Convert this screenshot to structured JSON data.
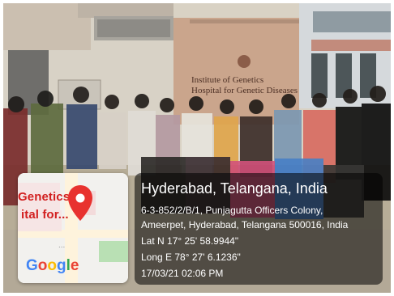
{
  "photo": {
    "building_sign": "Institute of Genetics\nHospital for Genetic Diseases",
    "colors": {
      "wall_light": "#d8d0c1",
      "wall_shadow": "#8c857b",
      "sign_panel": "#cdb49b",
      "ground": "#b7ad97",
      "sky": "#e9eef2"
    }
  },
  "map_overlay": {
    "label_line_1": "Genetics",
    "label_line_2": "ital for...",
    "map_logo": "Google",
    "pin_icon": "map-pin-icon",
    "pin_color": "#e8322f",
    "road_color": "#fef3dc",
    "park_color": "#b9e0b4"
  },
  "location_info": {
    "place": "Hyderabad, Telangana, India",
    "address_line_1": "6-3-852/2/B/1, Punjagutta Officers Colony,",
    "address_line_2": "Ameerpet, Hyderabad, Telangana 500016, India",
    "lat": "Lat N 17° 25' 58.9944\"",
    "long": "Long E 78° 27' 6.1236\"",
    "timestamp": "17/03/21 02:06 PM"
  }
}
